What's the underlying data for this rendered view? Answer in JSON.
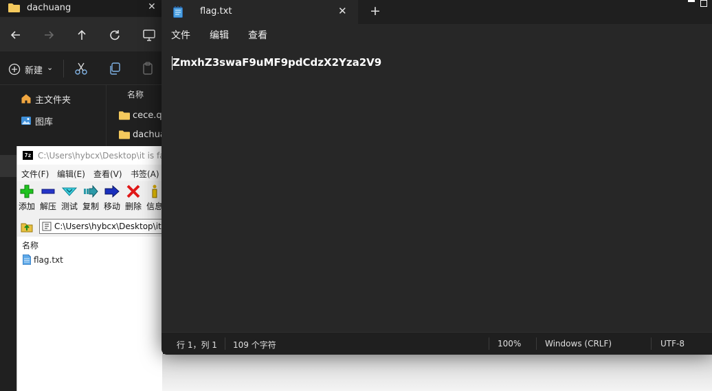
{
  "explorer": {
    "tab_title": "dachuang",
    "close_glyph": "✕",
    "new_button": "新建",
    "new_chevron": "⌄",
    "sidebar": [
      {
        "label": "主文件夹",
        "icon": "home-icon"
      },
      {
        "label": "图库",
        "icon": "gallery-icon"
      }
    ],
    "column_name": "名称",
    "files": [
      "cece.qi",
      "dachua"
    ],
    "folder_color": "#f4c95d"
  },
  "sevenzip": {
    "logo": "7z",
    "title": "C:\\Users\\hybcx\\Desktop\\it is fake.z",
    "menus": [
      "文件(F)",
      "编辑(E)",
      "查看(V)",
      "书签(A)"
    ],
    "tools": [
      {
        "label": "添加",
        "icon": "add-icon"
      },
      {
        "label": "解压",
        "icon": "extract-icon"
      },
      {
        "label": "测试",
        "icon": "test-icon"
      },
      {
        "label": "复制",
        "icon": "copy-icon"
      },
      {
        "label": "移动",
        "icon": "move-icon"
      },
      {
        "label": "删除",
        "icon": "delete-icon"
      },
      {
        "label": "信息",
        "icon": "info-icon"
      }
    ],
    "path": "C:\\Users\\hybcx\\Desktop\\it",
    "column_name": "名称",
    "files": [
      "flag.txt"
    ]
  },
  "notepad": {
    "tab_title": "flag.txt",
    "close_glyph": "✕",
    "new_tab_glyph": "+",
    "menus": [
      "文件",
      "编辑",
      "查看"
    ],
    "content": "ZmxhZ3swaF9uMF9pdCdzX2Yza2V9",
    "status": {
      "position": "行 1，列 1",
      "char_count": "109 个字符",
      "zoom": "100%",
      "line_ending": "Windows (CRLF)",
      "encoding": "UTF-8"
    }
  }
}
